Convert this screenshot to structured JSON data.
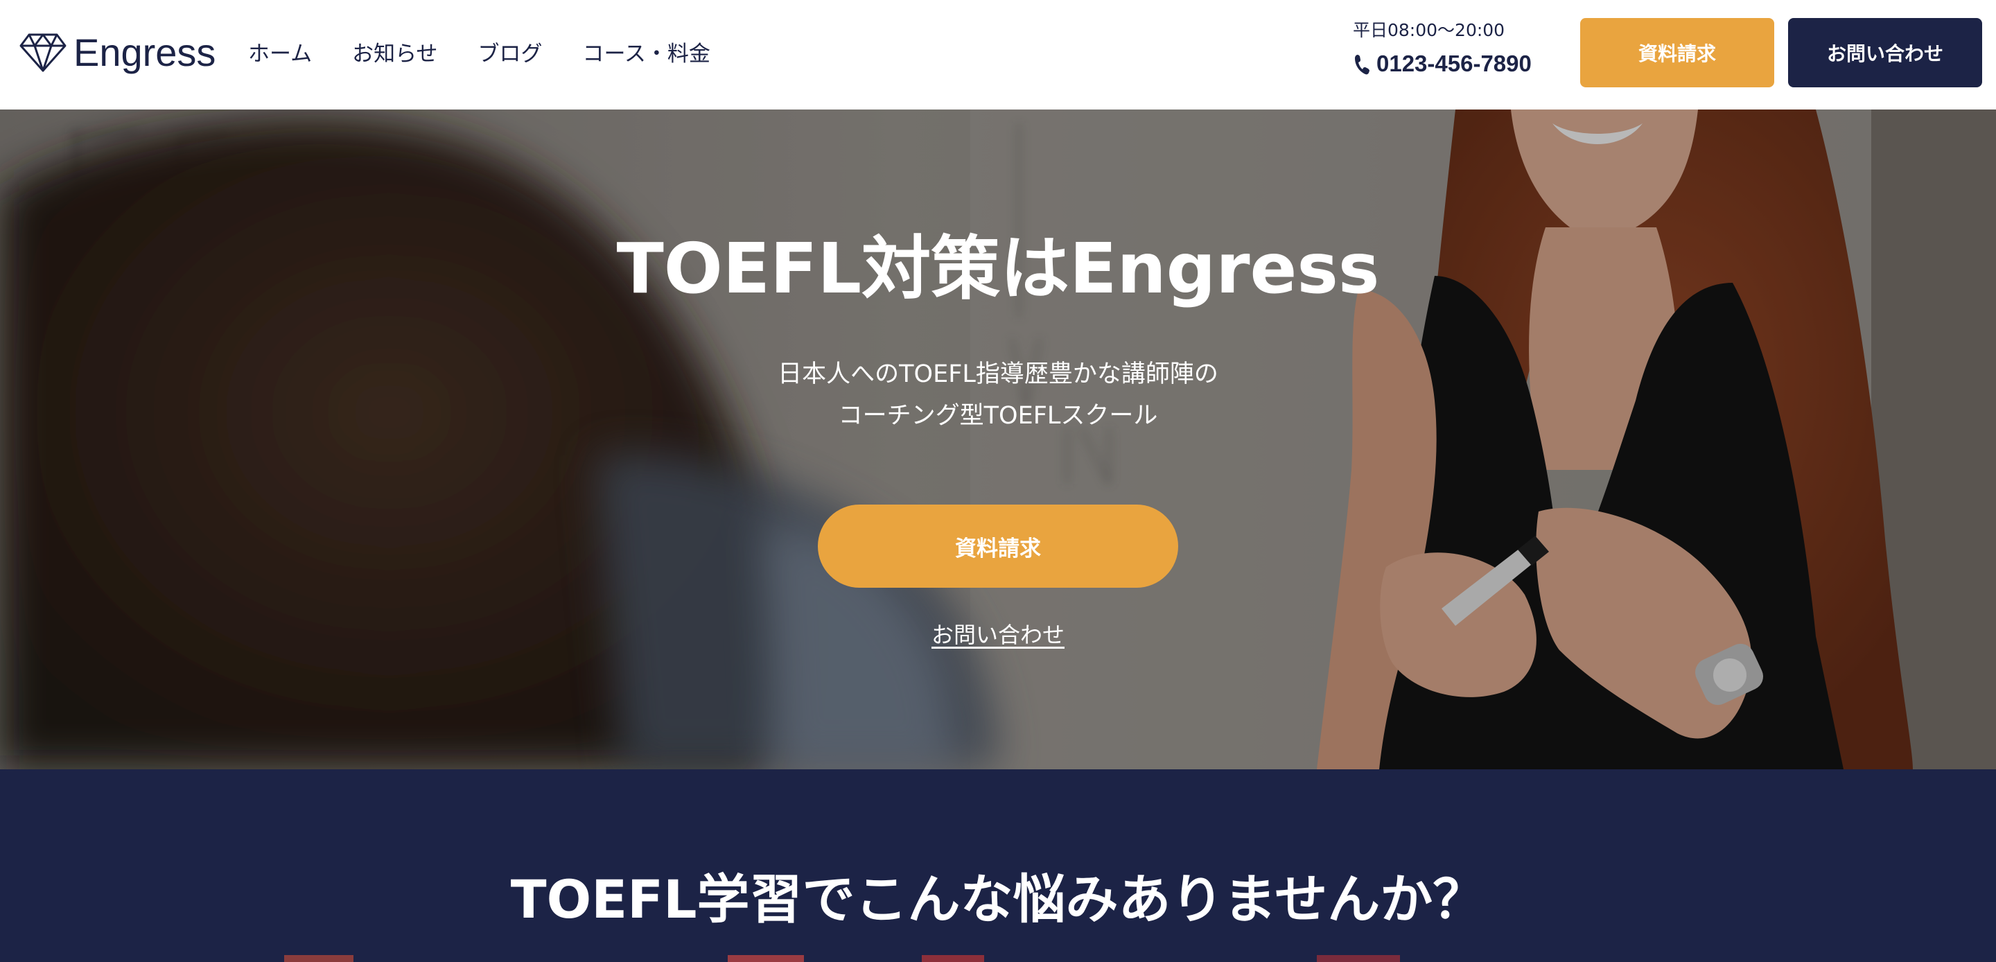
{
  "header": {
    "logo_text": "Engress",
    "nav": [
      "ホーム",
      "お知らせ",
      "ブログ",
      "コース・料金"
    ],
    "hours": "平日08:00〜20:00",
    "phone": "0123-456-7890",
    "request_button": "資料請求",
    "contact_button": "お問い合わせ"
  },
  "hero": {
    "title": "TOEFL対策はEngress",
    "subtitle_lines": [
      "日本人へのTOEFL指導歴豊かな講師陣の",
      "コーチング型TOEFLスクール"
    ],
    "request_button": "資料請求",
    "contact_link": "お問い合わせ"
  },
  "problems": {
    "heading": "TOEFL学習でこんな悩みありませんか？"
  },
  "colors": {
    "navy": "#1c2346",
    "accent_orange": "#e9a43f",
    "white": "#ffffff"
  },
  "icons": {
    "logo": "diamond-icon",
    "phone": "phone-icon"
  }
}
